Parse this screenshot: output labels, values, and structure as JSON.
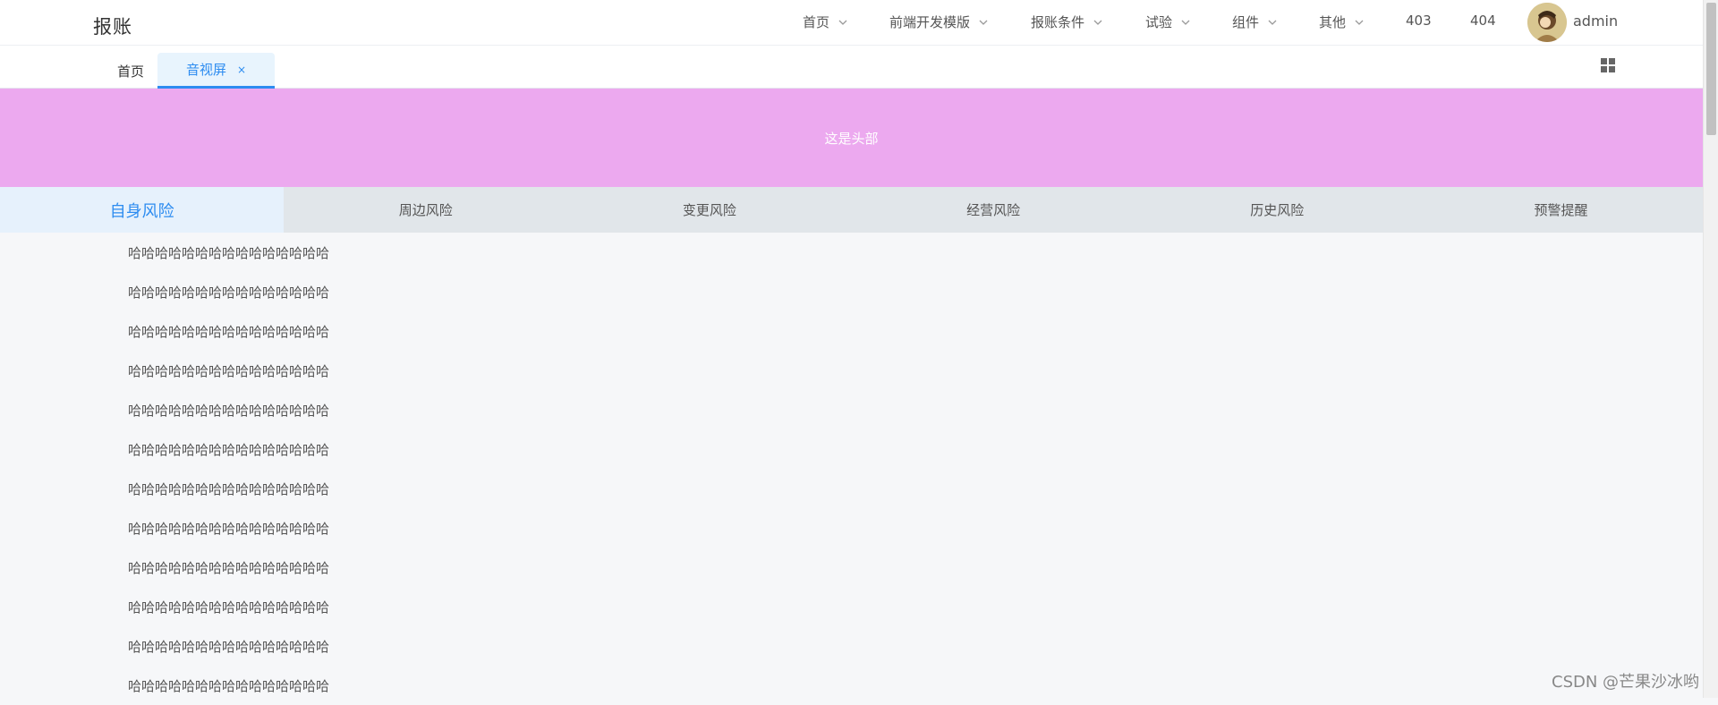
{
  "brand": "报账",
  "nav": {
    "items": [
      {
        "label": "首页",
        "dropdown": true
      },
      {
        "label": "前端开发模版",
        "dropdown": true
      },
      {
        "label": "报账条件",
        "dropdown": true
      },
      {
        "label": "试验",
        "dropdown": true
      },
      {
        "label": "组件",
        "dropdown": true
      },
      {
        "label": "其他",
        "dropdown": true
      },
      {
        "label": "403",
        "dropdown": false
      },
      {
        "label": "404",
        "dropdown": false
      }
    ],
    "username": "admin"
  },
  "tabs": {
    "home_label": "首页",
    "active_label": "音视屏",
    "close_glyph": "×"
  },
  "header_text": "这是头部",
  "risk_tabs": [
    {
      "label": "自身风险",
      "active": true
    },
    {
      "label": "周边风险",
      "active": false
    },
    {
      "label": "变更风险",
      "active": false
    },
    {
      "label": "经营风险",
      "active": false
    },
    {
      "label": "历史风险",
      "active": false
    },
    {
      "label": "预警提醒",
      "active": false
    }
  ],
  "content_lines": [
    "哈哈哈哈哈哈哈哈哈哈哈哈哈哈哈",
    "哈哈哈哈哈哈哈哈哈哈哈哈哈哈哈",
    "哈哈哈哈哈哈哈哈哈哈哈哈哈哈哈",
    "哈哈哈哈哈哈哈哈哈哈哈哈哈哈哈",
    "哈哈哈哈哈哈哈哈哈哈哈哈哈哈哈",
    "哈哈哈哈哈哈哈哈哈哈哈哈哈哈哈",
    "哈哈哈哈哈哈哈哈哈哈哈哈哈哈哈",
    "哈哈哈哈哈哈哈哈哈哈哈哈哈哈哈",
    "哈哈哈哈哈哈哈哈哈哈哈哈哈哈哈",
    "哈哈哈哈哈哈哈哈哈哈哈哈哈哈哈",
    "哈哈哈哈哈哈哈哈哈哈哈哈哈哈哈",
    "哈哈哈哈哈哈哈哈哈哈哈哈哈哈哈"
  ],
  "watermark": "CSDN @芒果沙冰哟",
  "colors": {
    "accent": "#2d8cf0",
    "header_bg": "#eca9ef",
    "risk_bar_bg": "#e1e6ea",
    "page_bg": "#f6f7f9"
  },
  "icons": {
    "chevron": "chevron-down-icon",
    "grid": "grid-icon",
    "close": "close-icon"
  }
}
